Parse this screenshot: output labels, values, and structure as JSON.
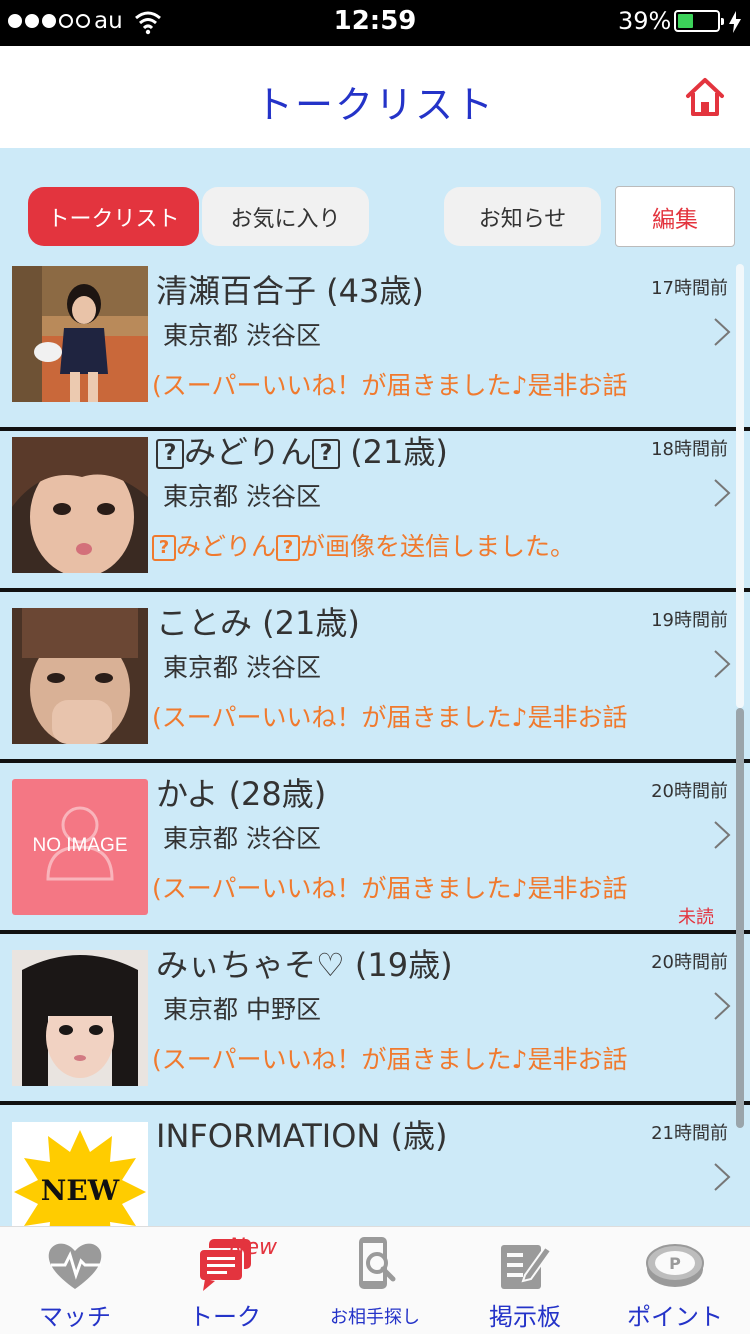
{
  "status_bar": {
    "carrier": "au",
    "time": "12:59",
    "battery_percent": "39%",
    "battery_level": 0.39,
    "signal_bars_filled": 3,
    "signal_bars_total": 5
  },
  "header": {
    "title": "トークリスト",
    "home_icon": "home-icon"
  },
  "tabs": {
    "talk_list": "トークリスト",
    "favorites": "お気に入り",
    "notices": "お知らせ",
    "edit": "編集"
  },
  "threads": [
    {
      "name": "清瀬百合子 (43歳)",
      "time": "17時間前",
      "area": "東京都 渋谷区",
      "message": "(スーパーいいね！が届きました♪是非お話"
    },
    {
      "name_mid": "みどりん",
      "name_age": " (21歳)",
      "time": "18時間前",
      "area": "東京都 渋谷区",
      "message_mid": "みどりん",
      "message_end": "が画像を送信しました。",
      "placeholder_glyph": "?"
    },
    {
      "name": "ことみ (21歳)",
      "time": "19時間前",
      "area": "東京都 渋谷区",
      "message": "(スーパーいいね！が届きました♪是非お話"
    },
    {
      "name": "かよ (28歳)",
      "time": "20時間前",
      "area": "東京都 渋谷区",
      "message": "(スーパーいいね！が届きました♪是非お話",
      "unread": "未読",
      "avatar_text": "NO IMAGE"
    },
    {
      "name": "みぃちゃそ♡ (19歳)",
      "time": "20時間前",
      "area": "東京都 中野区",
      "message": "(スーパーいいね！が届きました♪是非お話"
    },
    {
      "name": "INFORMATION (歳)",
      "time": "21時間前",
      "avatar_text": "NEW"
    }
  ],
  "tab_bar": {
    "match": "マッチ",
    "talk": "トーク",
    "talk_badge": "New",
    "search": "お相手探し",
    "board": "掲示板",
    "points": "ポイント"
  },
  "colors": {
    "accent_red": "#e3343e",
    "title_blue": "#2433c8",
    "list_bg": "#cdeaf8",
    "message_orange": "#f07a2e"
  }
}
